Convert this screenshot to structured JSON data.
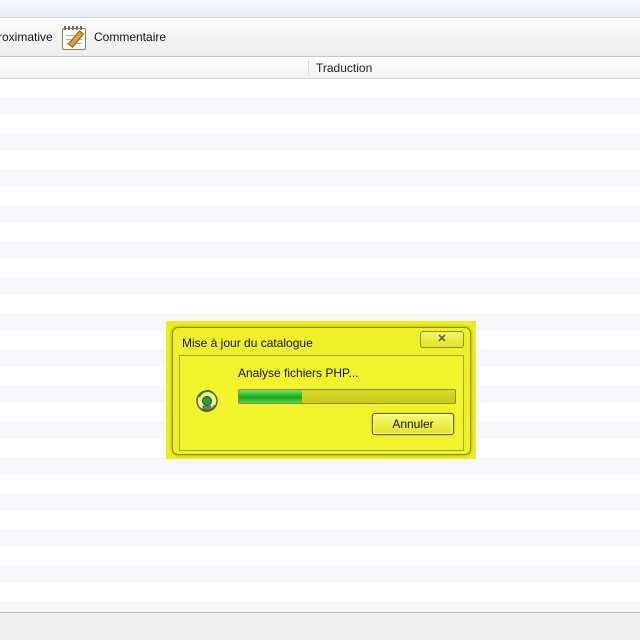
{
  "toolbar": {
    "approx_label": "roximative",
    "comment_label": "Commentaire"
  },
  "list": {
    "columns": [
      "",
      "Traduction"
    ]
  },
  "dialog": {
    "title": "Mise à jour du catalogue",
    "close_glyph": "✕",
    "message": "Analyse fichiers PHP...",
    "progress": 0.29,
    "cancel_label": "Annuler"
  },
  "colors": {
    "highlight": "#ECEE1C",
    "progress_fill": "#25B420"
  },
  "icons": {
    "comment": "notepad-pencil-icon",
    "dialog": "catalog-update-icon",
    "close": "close-icon"
  }
}
